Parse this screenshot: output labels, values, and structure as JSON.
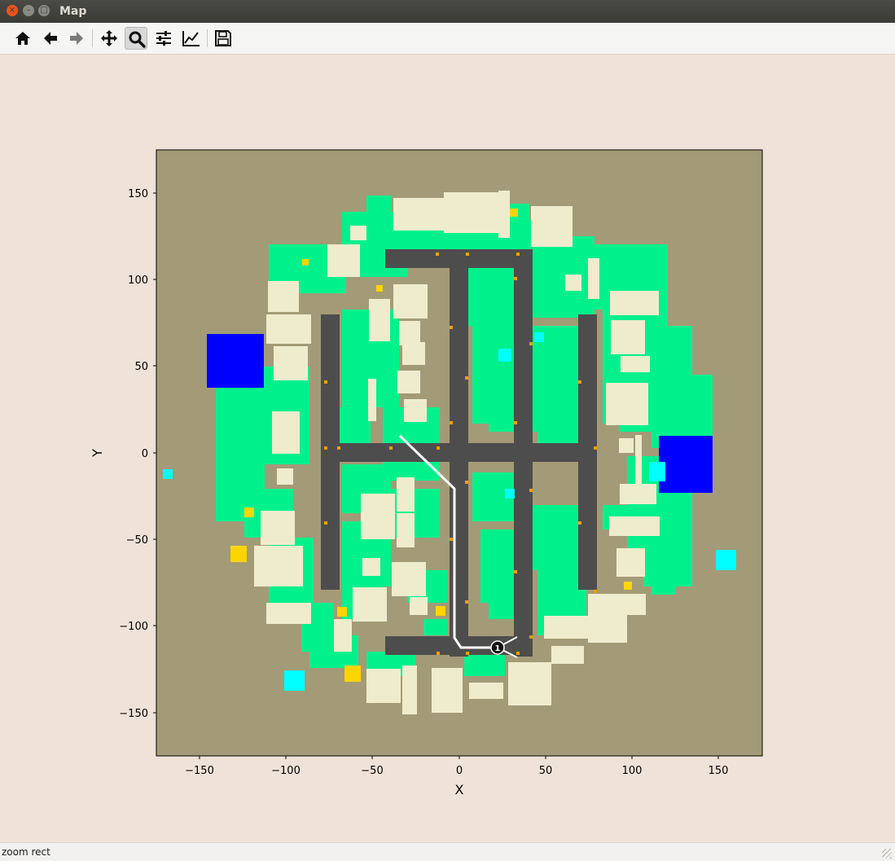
{
  "window": {
    "title": "Map"
  },
  "toolbar": {
    "buttons": [
      {
        "icon": "home-icon",
        "state": "enabled"
      },
      {
        "icon": "back-arrow-icon",
        "state": "enabled"
      },
      {
        "icon": "forward-arrow-icon",
        "state": "disabled"
      },
      {
        "icon": "pan-move-icon",
        "state": "enabled"
      },
      {
        "icon": "zoom-magnifier-icon",
        "state": "active"
      },
      {
        "icon": "configure-subplots-icon",
        "state": "enabled"
      },
      {
        "icon": "edit-axes-line-icon",
        "state": "enabled"
      },
      {
        "icon": "save-floppy-icon",
        "state": "enabled"
      }
    ]
  },
  "status": {
    "text": "zoom rect"
  },
  "plot": {
    "xlabel": "X",
    "ylabel": "Y",
    "xticks": [
      "−150",
      "−100",
      "−50",
      "0",
      "50",
      "100",
      "150"
    ],
    "yticks": [
      "150",
      "100",
      "50",
      "0",
      "−50",
      "−100",
      "−150"
    ],
    "marker_label": "1",
    "colors": {
      "background": "#a39b77",
      "road": "#4d4d4d",
      "building": "#efecce",
      "vegetation": "#00f08c",
      "water_blue": "#0000ff",
      "cyan": "#00ffff",
      "yellow": "#ffd400",
      "path": "#ffffff"
    }
  }
}
